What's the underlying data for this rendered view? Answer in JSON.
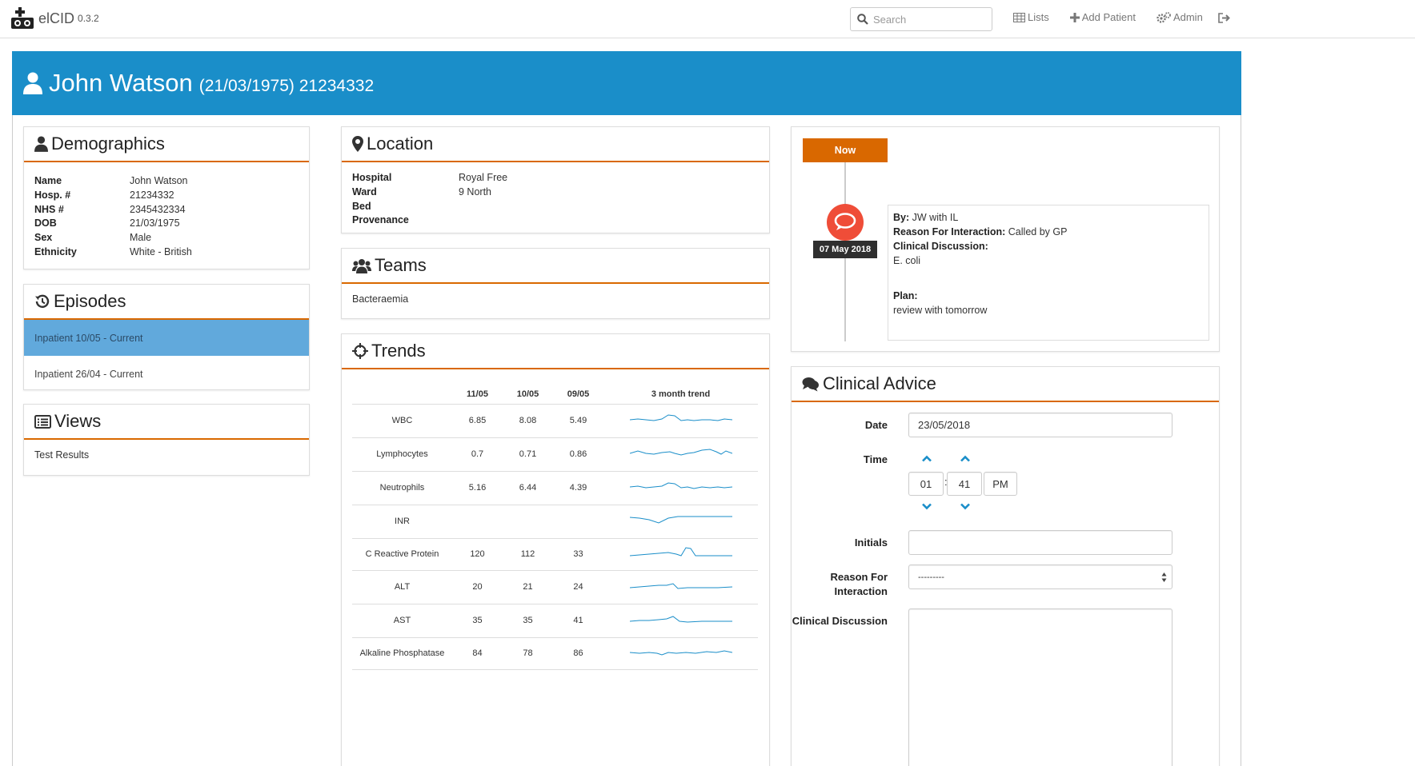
{
  "app": {
    "name": "elCID",
    "version": "0.3.2"
  },
  "nav": {
    "search_placeholder": "Search",
    "lists": "Lists",
    "add_patient": "Add Patient",
    "admin": "Admin"
  },
  "patient": {
    "name": "John Watson",
    "subtitle": "(21/03/1975) 21234332"
  },
  "demographics": {
    "title": "Demographics",
    "rows": [
      {
        "label": "Name",
        "value": "John Watson"
      },
      {
        "label": "Hosp. #",
        "value": "21234332"
      },
      {
        "label": "NHS #",
        "value": "2345432334"
      },
      {
        "label": "DOB",
        "value": "21/03/1975"
      },
      {
        "label": "Sex",
        "value": "Male"
      },
      {
        "label": "Ethnicity",
        "value": "White - British"
      }
    ]
  },
  "episodes": {
    "title": "Episodes",
    "items": [
      "Inpatient 10/05 - Current",
      "Inpatient 26/04 - Current"
    ]
  },
  "views": {
    "title": "Views",
    "items": [
      "Test Results"
    ]
  },
  "location": {
    "title": "Location",
    "rows": [
      {
        "label": "Hospital",
        "value": "Royal Free"
      },
      {
        "label": "Ward",
        "value": "9 North"
      },
      {
        "label": "Bed",
        "value": ""
      },
      {
        "label": "Provenance",
        "value": ""
      }
    ]
  },
  "teams": {
    "title": "Teams",
    "items": [
      "Bacteraemia"
    ]
  },
  "trends": {
    "title": "Trends",
    "columns": [
      "",
      "11/05",
      "10/05",
      "09/05",
      "3 month trend"
    ],
    "rows": [
      {
        "name": "WBC",
        "v": [
          "6.85",
          "8.08",
          "5.49"
        ]
      },
      {
        "name": "Lymphocytes",
        "v": [
          "0.7",
          "0.71",
          "0.86"
        ]
      },
      {
        "name": "Neutrophils",
        "v": [
          "5.16",
          "6.44",
          "4.39"
        ]
      },
      {
        "name": "INR",
        "v": [
          "",
          "",
          ""
        ]
      },
      {
        "name": "C Reactive Protein",
        "v": [
          "120",
          "112",
          "33"
        ]
      },
      {
        "name": "ALT",
        "v": [
          "20",
          "21",
          "24"
        ]
      },
      {
        "name": "AST",
        "v": [
          "35",
          "35",
          "41"
        ]
      },
      {
        "name": "Alkaline Phosphatase",
        "v": [
          "84",
          "78",
          "86"
        ]
      }
    ]
  },
  "timeline": {
    "now_label": "Now",
    "date": "07 May 2018",
    "by_label": "By:",
    "by_value": "JW with IL",
    "reason_label": "Reason For Interaction:",
    "reason_value": "Called by GP",
    "discussion_label": "Clinical Discussion:",
    "discussion_value": "E. coli",
    "plan_label": "Plan:",
    "plan_value": "review with tomorrow"
  },
  "clinical_advice": {
    "title": "Clinical Advice",
    "date_label": "Date",
    "date_value": "23/05/2018",
    "time_label": "Time",
    "hour": "01",
    "minute": "41",
    "meridian": "PM",
    "initials_label": "Initials",
    "initials_value": "",
    "reason_label": "Reason For Interaction",
    "reason_value": "---------",
    "discussion_label": "Clinical Discussion"
  },
  "colors": {
    "accent": "#d96800",
    "banner": "#1a8ec9",
    "episode_active": "#61a9dc",
    "trend_line": "#1a8ec9"
  }
}
